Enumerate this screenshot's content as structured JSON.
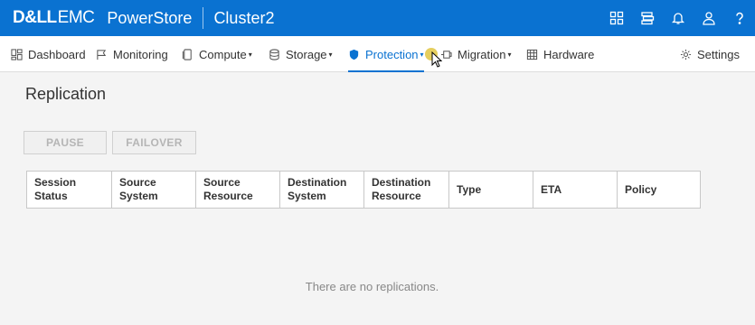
{
  "header": {
    "logo_bold": "D&LL",
    "logo_light": "EMC",
    "product": "PowerStore",
    "cluster": "Cluster2",
    "icons": [
      "grid-apps-icon",
      "jobs-icon",
      "bell-icon",
      "user-icon",
      "help-icon"
    ]
  },
  "nav": {
    "items": [
      {
        "label": "Dashboard",
        "icon": "dashboard-icon"
      },
      {
        "label": "Monitoring",
        "icon": "flag-icon"
      },
      {
        "label": "Compute",
        "icon": "compute-icon",
        "dropdown": true
      },
      {
        "label": "Storage",
        "icon": "storage-icon",
        "dropdown": true
      },
      {
        "label": "Protection",
        "icon": "shield-icon",
        "dropdown": true,
        "active": true
      },
      {
        "label": "Migration",
        "icon": "migration-icon",
        "dropdown": true
      },
      {
        "label": "Hardware",
        "icon": "hardware-icon"
      },
      {
        "label": "Settings",
        "icon": "gear-icon"
      }
    ],
    "caret": "▾"
  },
  "page": {
    "title": "Replication",
    "buttons": {
      "pause": "PAUSE",
      "failover": "FAILOVER"
    },
    "columns": [
      [
        "Session",
        "Status"
      ],
      [
        "Source",
        "System"
      ],
      [
        "Source",
        "Resource"
      ],
      [
        "Destination",
        "System"
      ],
      [
        "Destination",
        "Resource"
      ],
      [
        "Type"
      ],
      [
        "ETA"
      ],
      [
        "Policy"
      ]
    ],
    "empty_message": "There are no replications."
  },
  "colors": {
    "brand": "#0a72d1",
    "highlight": "#dcbe28"
  }
}
